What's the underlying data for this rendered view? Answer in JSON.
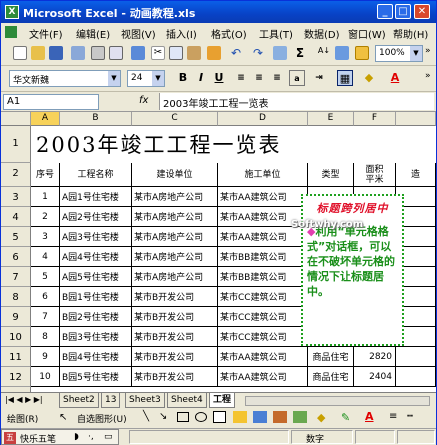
{
  "window": {
    "title": "Microsoft Excel - 动画教程.xls",
    "icon": "excel-icon"
  },
  "menu": [
    "文件(F)",
    "编辑(E)",
    "视图(V)",
    "插入(I)",
    "格式(O)",
    "工具(T)",
    "数据(D)",
    "窗口(W)",
    "帮助(H)"
  ],
  "format_toolbar": {
    "font": "华文新魏",
    "size": "24",
    "zoom": "100%",
    "bold": "B",
    "italic": "I",
    "underline": "U"
  },
  "formula_bar": {
    "name_box": "A1",
    "fx": "fx",
    "value": "2003年竣工工程一览表"
  },
  "columns": [
    "A",
    "B",
    "C",
    "D",
    "E",
    "F"
  ],
  "col_g_partial": "",
  "row_numbers": [
    "1",
    "2",
    "3",
    "4",
    "5",
    "6",
    "7",
    "8",
    "9",
    "10",
    "11",
    "12"
  ],
  "sheet": {
    "title": "2003年竣工工程一览表",
    "headers": [
      "序号",
      "工程名称",
      "建设单位",
      "施工单位",
      "类型",
      "面积\n平米",
      "造"
    ],
    "rows": [
      [
        "1",
        "A园1号住宅楼",
        "某市A房地产公司",
        "某市AA建筑公司",
        "",
        ""
      ],
      [
        "2",
        "A园2号住宅楼",
        "某市A房地产公司",
        "某市AA建筑公司",
        "",
        ""
      ],
      [
        "3",
        "A园3号住宅楼",
        "某市A房地产公司",
        "某市AA建筑公司",
        "",
        ""
      ],
      [
        "4",
        "A园4号住宅楼",
        "某市A房地产公司",
        "某市BB建筑公司",
        "",
        ""
      ],
      [
        "5",
        "A园5号住宅楼",
        "某市A房地产公司",
        "某市BB建筑公司",
        "",
        ""
      ],
      [
        "6",
        "B园1号住宅楼",
        "某市B开发公司",
        "某市CC建筑公司",
        "",
        ""
      ],
      [
        "7",
        "B园2号住宅楼",
        "某市B开发公司",
        "某市CC建筑公司",
        "",
        ""
      ],
      [
        "8",
        "B园3号住宅楼",
        "某市B开发公司",
        "某市CC建筑公司",
        "",
        ""
      ],
      [
        "9",
        "B园4号住宅楼",
        "某市B开发公司",
        "某市AA建筑公司",
        "商品住宅",
        "2820"
      ],
      [
        "10",
        "B园5号住宅楼",
        "某市B开发公司",
        "某市AA建筑公司",
        "商品住宅",
        "2404"
      ]
    ]
  },
  "callout": {
    "title": "标题跨列居中",
    "body_marker": "◆",
    "body": "利用“单元格格式”对话框，可以在不破坏单元格的情况下让标题居中。"
  },
  "watermark": "Softwhy.com",
  "sheet_tabs": [
    "Sheet2",
    "13",
    "Sheet3",
    "Sheet4",
    "工程"
  ],
  "draw_toolbar": {
    "draw": "绘图(R)",
    "autoshape": "自选图形(U)"
  },
  "status": {
    "ime": "快乐五笔",
    "mode": "数字"
  }
}
